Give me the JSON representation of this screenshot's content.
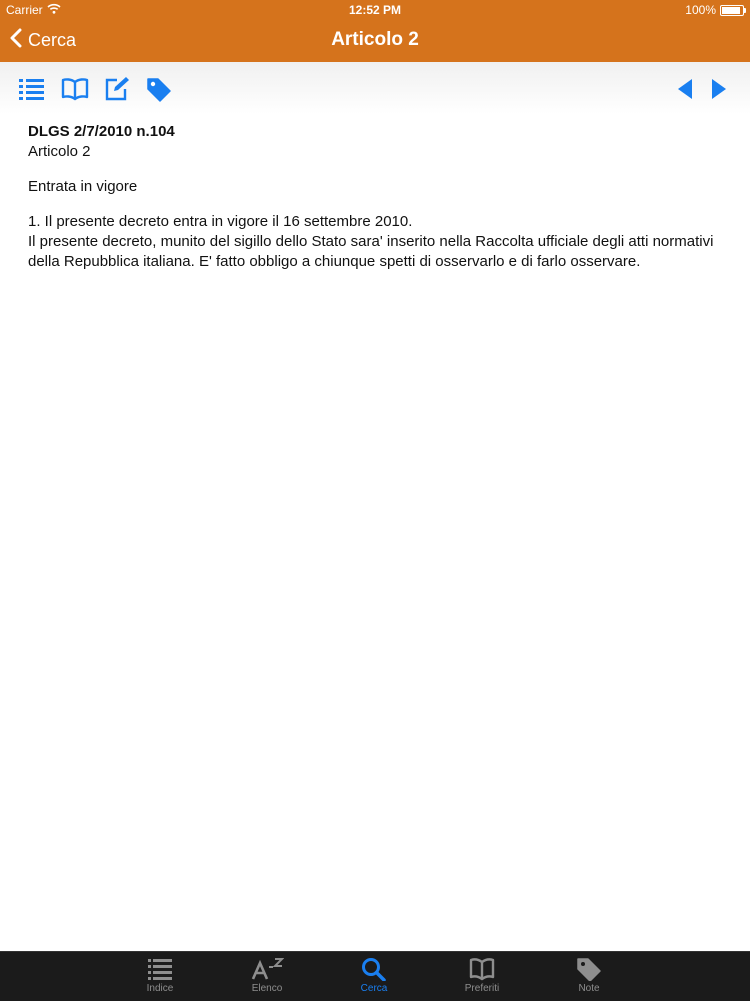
{
  "status": {
    "carrier": "Carrier",
    "time": "12:52 PM",
    "battery": "100%"
  },
  "nav": {
    "back_label": "Cerca",
    "title": "Articolo 2"
  },
  "toolbar": {
    "icons": [
      "list-icon",
      "book-icon",
      "edit-icon",
      "tag-icon",
      "previous-arrow-icon",
      "next-arrow-icon"
    ]
  },
  "document": {
    "title": "DLGS 2/7/2010 n.104",
    "article": "Articolo 2",
    "section": "Entrata in vigore",
    "line1": "1. Il presente decreto entra in vigore il 16 settembre 2010.",
    "line2": "Il presente decreto, munito del sigillo dello Stato sara' inserito nella Raccolta ufficiale degli atti normativi della Repubblica italiana. E' fatto obbligo a chiunque spetti di osservarlo e di farlo osservare."
  },
  "tabs": [
    {
      "label": "Indice",
      "active": false
    },
    {
      "label": "Elenco",
      "active": false
    },
    {
      "label": "Cerca",
      "active": true
    },
    {
      "label": "Preferiti",
      "active": false
    },
    {
      "label": "Note",
      "active": false
    }
  ],
  "colors": {
    "accent": "#d5731c",
    "tint": "#1a7ff0",
    "tabbar": "#1b1b1b",
    "tab_inactive": "#8e8e8e"
  }
}
